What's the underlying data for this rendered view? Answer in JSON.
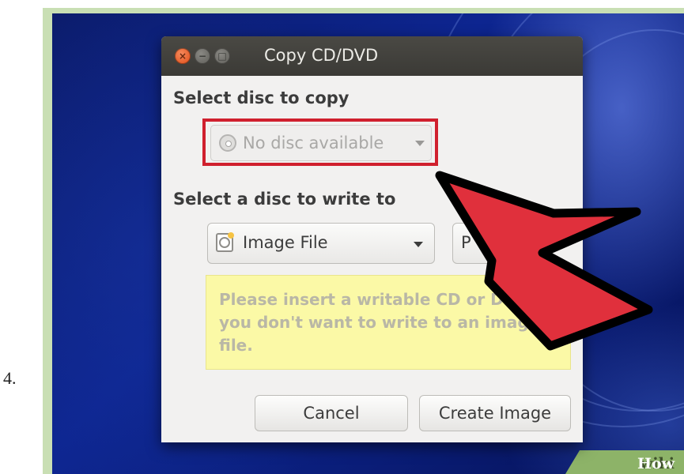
{
  "step_number": "4.",
  "watermark": {
    "part1": "wiki",
    "part2": "How"
  },
  "dialog": {
    "title": "Copy CD/DVD",
    "window_buttons": {
      "close": "×",
      "minimize": "−",
      "maximize": "□"
    },
    "source_section_label": "Select disc to copy",
    "source_combo_value": "No disc available",
    "destination_section_label": "Select a disc to write to",
    "destination_combo_value": "Image File",
    "properties_button_label": "P",
    "info_message": "Please insert a writable CD or DVD if you don't want to write to an image file.",
    "cancel_label": "Cancel",
    "create_label": "Create Image"
  },
  "colors": {
    "highlight": "#d0202e",
    "arrow": "#e0303c",
    "info_background": "#fbf9a6"
  },
  "icons": {
    "source": "disc-icon",
    "destination": "image-file-icon",
    "dropdown": "chevron-down-icon",
    "annotation": "pointer-arrow-icon"
  }
}
